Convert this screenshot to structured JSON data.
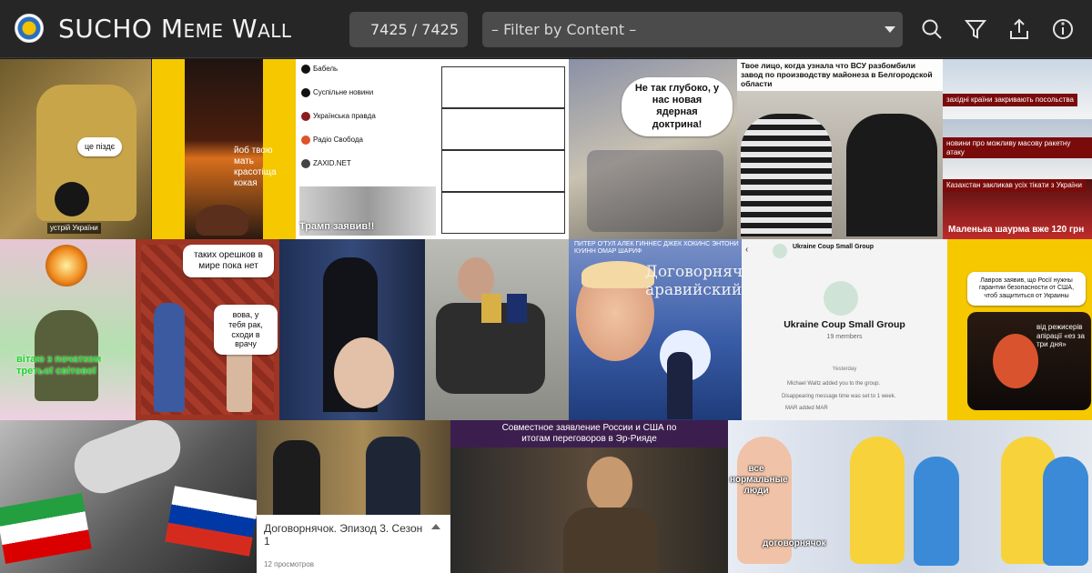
{
  "header": {
    "title": "SUCHO Meme Wall",
    "counter": "7425 / 7425",
    "filter_placeholder": "– Filter by Content –",
    "icons": [
      "search-icon",
      "filter-icon",
      "share-icon",
      "info-icon"
    ]
  },
  "colors": {
    "topbar": "#262626",
    "control": "#4b4b4b",
    "yellow": "#f5c800",
    "text": "#e4e4e4"
  },
  "memes": {
    "m1_bubble": "це піздє",
    "m1_label": "устрій України",
    "m2_text": "йоб твою мать красотіща кокая",
    "m3_channels": [
      "Бабель",
      "Суспільне новини",
      "Українська правда",
      "Радіо Свобода",
      "ZAXID.NET"
    ],
    "m3_caption": "Трамп заявив!!",
    "m4_bubble": "Не так глубоко, у нас новая ядерная доктрина!",
    "m5_caption": "Твое лицо, когда узнала что ВСУ разбомбили завод по производству майонеза в Белгородской области",
    "m6_lines": [
      "західні країни закривають посольства",
      "новини про можливу масову ракетну атаку",
      "Казахстан закликав усіх тікати з України"
    ],
    "m6_bottom": "Маленька шаурма вже 120 грн",
    "m7_text": "вітаю з початком третьої світової",
    "m8_bubble1": "таких орешков в мире пока нет",
    "m8_bubble2": "вова, у тебя рак, сходи в врачу",
    "m10_authors": "ПИТЕР О'ТУЛ  АЛЕК ГИННЕС  ДЖЕК ХОКИНС  ЭНТОНИ КУИНН  ОМАР ШАРИФ",
    "m10_title": "Договорнячок аравийский",
    "m11_group_header": "Ukraine Coup Small Group",
    "m11_group_name": "Ukraine Coup Small Group",
    "m11_members": "19 members",
    "m11_yesterday": "Yesterday",
    "m11_events": [
      "Michael Waltz added you to the group.",
      "Disappearing message time was set to 1 week.",
      "MAR added MAR"
    ],
    "m12_bubble": "Лавров заявив, що Росії нужны гарантии безопасности от США, чтоб защититься от Украины",
    "m12_caption": "від режисерів апірації «ез за три дня»",
    "m14_title": "Договорнячок. Эпизод 3. Сезон 1",
    "m14_views": "12 просмотров",
    "m15_header": "Совместное заявление России и США по итогам переговоров в Эр-Рияде",
    "m16_label1": "все нормальные люди",
    "m16_label2": "договорнячок"
  }
}
